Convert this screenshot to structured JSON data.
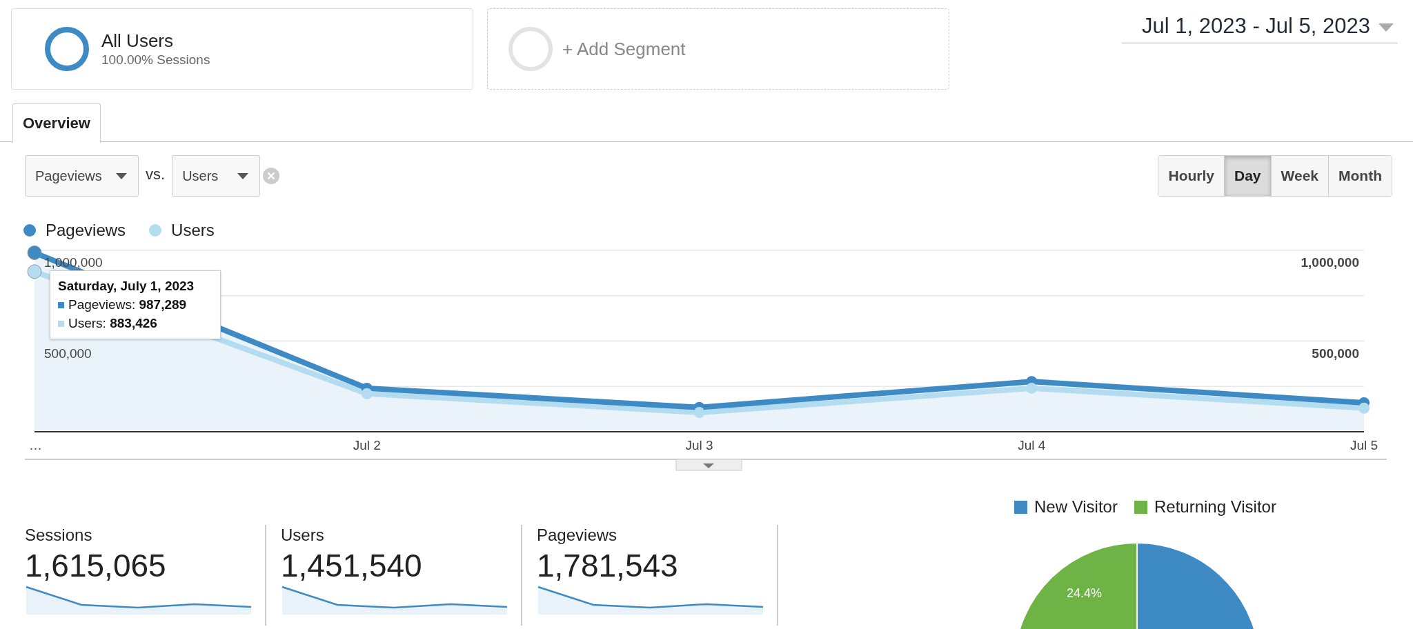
{
  "segments": [
    {
      "kind": "active",
      "name": "All Users",
      "detail": "100.00% Sessions"
    },
    {
      "kind": "add",
      "name": "+ Add Segment"
    }
  ],
  "date_range": "Jul 1, 2023 - Jul 5, 2023",
  "tabs": [
    {
      "label": "Overview",
      "selected": true
    }
  ],
  "metric_selectors": {
    "primary": "Pageviews",
    "vs": "vs.",
    "secondary": "Users"
  },
  "granularity": [
    {
      "label": "Hourly",
      "selected": false
    },
    {
      "label": "Day",
      "selected": true
    },
    {
      "label": "Week",
      "selected": false
    },
    {
      "label": "Month",
      "selected": false
    }
  ],
  "main_chart": {
    "chart_data": {
      "type": "line",
      "categories": [
        "…",
        "Jul 2",
        "Jul 3",
        "Jul 4",
        "Jul 5"
      ],
      "series": [
        {
          "name": "Pageviews",
          "color": "#3d8ac4",
          "marker": true,
          "values": [
            987000,
            240000,
            134000,
            277000,
            160000
          ]
        },
        {
          "name": "Users",
          "color": "#b4dcf0",
          "marker": true,
          "values": [
            883000,
            210000,
            106000,
            240000,
            130000
          ]
        }
      ],
      "ylim": [
        0,
        1000000
      ],
      "yticks": [
        {
          "value": 500000,
          "label": "500,000"
        },
        {
          "value": 1000000,
          "label": "1,000,000"
        }
      ]
    },
    "tooltip": {
      "title": "Saturday, July 1, 2023",
      "lines": [
        "Pageviews: **987,289**",
        "Users: **883,426**"
      ]
    }
  },
  "scorecards": [
    {
      "label": "Sessions",
      "value": "1,615,065"
    },
    {
      "label": "Users",
      "value": "1,451,540"
    },
    {
      "label": "Pageviews",
      "value": "1,781,543"
    }
  ],
  "visitor_chart": {
    "chart_data": {
      "type": "pie",
      "categories": [
        "New Visitor",
        "Returning Visitor"
      ],
      "legend": "top",
      "series": [
        {
          "values": [
            75.6,
            24.4
          ]
        }
      ],
      "colors": [
        "#3d8ac4",
        "#6db345"
      ],
      "value_labels": [
        null,
        "24.4%"
      ]
    }
  }
}
